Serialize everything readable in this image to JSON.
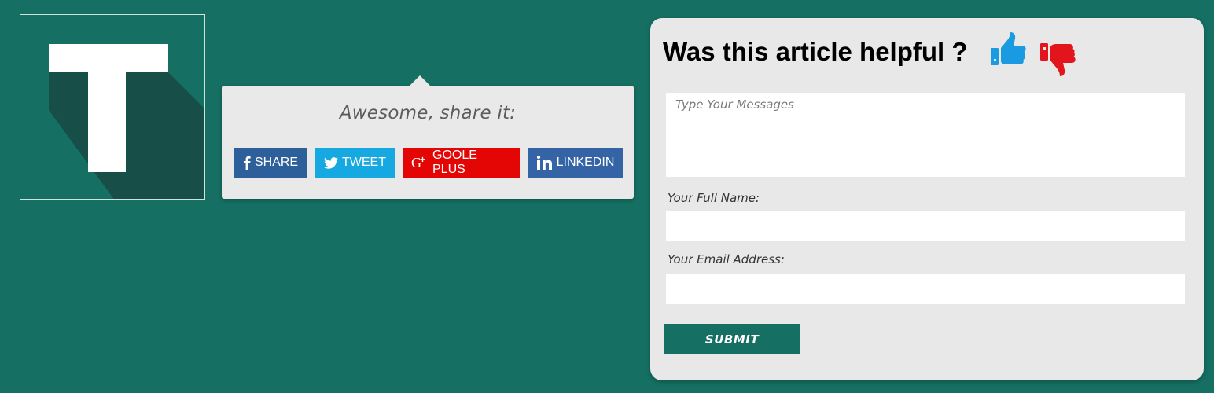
{
  "logo": {
    "letter": "T",
    "background_color": "#156f62",
    "shadow_color": "#174f48",
    "letter_color": "#ffffff"
  },
  "share": {
    "title": "Awesome, share it:",
    "buttons": [
      {
        "label": "SHARE",
        "icon": "facebook-icon",
        "color": "#2d5f9a"
      },
      {
        "label": "TWEET",
        "icon": "twitter-icon",
        "color": "#16a9e1"
      },
      {
        "label": "GOOLE PLUS",
        "icon": "google-plus-icon",
        "color": "#e40505"
      },
      {
        "label": "LINKEDIN",
        "icon": "linkedin-icon",
        "color": "#3564a6"
      }
    ]
  },
  "feedback": {
    "title": "Was this article helpful ?",
    "thumb_up_icon": "thumbs-up-icon",
    "thumb_down_icon": "thumbs-down-icon",
    "thumb_up_color": "#1a9ae0",
    "thumb_down_color": "#e2141c",
    "message_placeholder": "Type Your Messages",
    "name_label": "Your Full Name:",
    "email_label": "Your Email Address:",
    "submit_label": "SUBMIT"
  }
}
